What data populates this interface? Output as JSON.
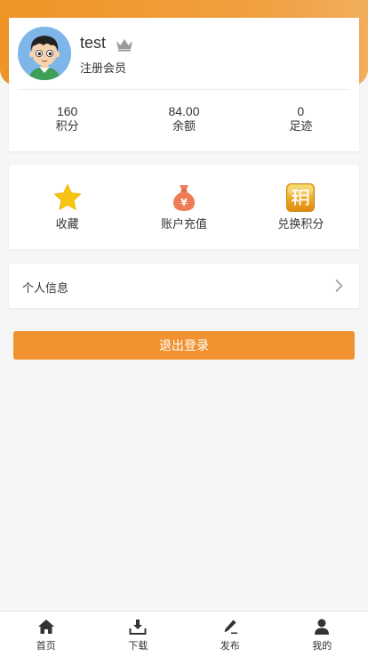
{
  "user": {
    "name": "test",
    "level": "注册会员",
    "avatar_icon": "boy-avatar-icon",
    "badge_icon": "crown-icon"
  },
  "stats": [
    {
      "value": "160",
      "label": "积分"
    },
    {
      "value": "84.00",
      "label": "余额"
    },
    {
      "value": "0",
      "label": "足迹"
    }
  ],
  "actions": [
    {
      "label": "收藏",
      "icon": "star-icon",
      "color": "#f5c20f"
    },
    {
      "label": "账户充值",
      "icon": "money-bag-icon",
      "color": "#ee7d56"
    },
    {
      "label": "兑换积分",
      "icon": "points-exchange-icon",
      "color": "#e89a1a"
    }
  ],
  "menu": {
    "profile_info": "个人信息"
  },
  "logout_label": "退出登录",
  "tabbar": [
    {
      "label": "首页",
      "icon": "home-icon"
    },
    {
      "label": "下载",
      "icon": "download-icon"
    },
    {
      "label": "发布",
      "icon": "pencil-icon"
    },
    {
      "label": "我的",
      "icon": "user-icon"
    }
  ],
  "colors": {
    "accent": "#ef922f",
    "header_gradient_start": "#ef9426",
    "header_gradient_end": "#f2ae5c",
    "background": "#f6f6f6"
  }
}
